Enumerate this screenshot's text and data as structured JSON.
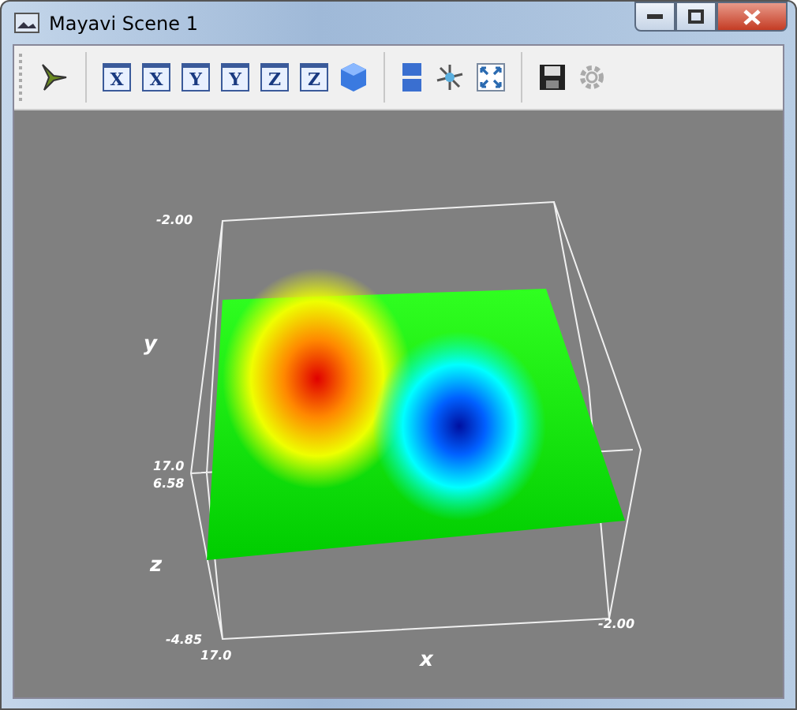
{
  "window": {
    "title": "Mayavi Scene 1"
  },
  "toolbar": [
    {
      "kind": "pipeline"
    },
    {
      "kind": "separator"
    },
    {
      "kind": "axis",
      "label": "X"
    },
    {
      "kind": "axis",
      "label": "X"
    },
    {
      "kind": "axis",
      "label": "Y"
    },
    {
      "kind": "axis",
      "label": "Y"
    },
    {
      "kind": "axis",
      "label": "Z"
    },
    {
      "kind": "axis",
      "label": "Z"
    },
    {
      "kind": "iso"
    },
    {
      "kind": "separator"
    },
    {
      "kind": "parallel"
    },
    {
      "kind": "axes"
    },
    {
      "kind": "fullscreen"
    },
    {
      "kind": "separator"
    },
    {
      "kind": "save"
    },
    {
      "kind": "settings"
    }
  ],
  "scene": {
    "labels": [
      {
        "kind": "tick",
        "text": "-2.00"
      },
      {
        "kind": "axis",
        "text": "y"
      },
      {
        "kind": "tick",
        "text": "17.0"
      },
      {
        "kind": "tick",
        "text": "6.58"
      },
      {
        "kind": "axis",
        "text": "z"
      },
      {
        "kind": "tick",
        "text": "-4.85"
      },
      {
        "kind": "tick",
        "text": "17.0"
      },
      {
        "kind": "axis",
        "text": "x"
      },
      {
        "kind": "tick",
        "text": "-2.00"
      }
    ]
  }
}
